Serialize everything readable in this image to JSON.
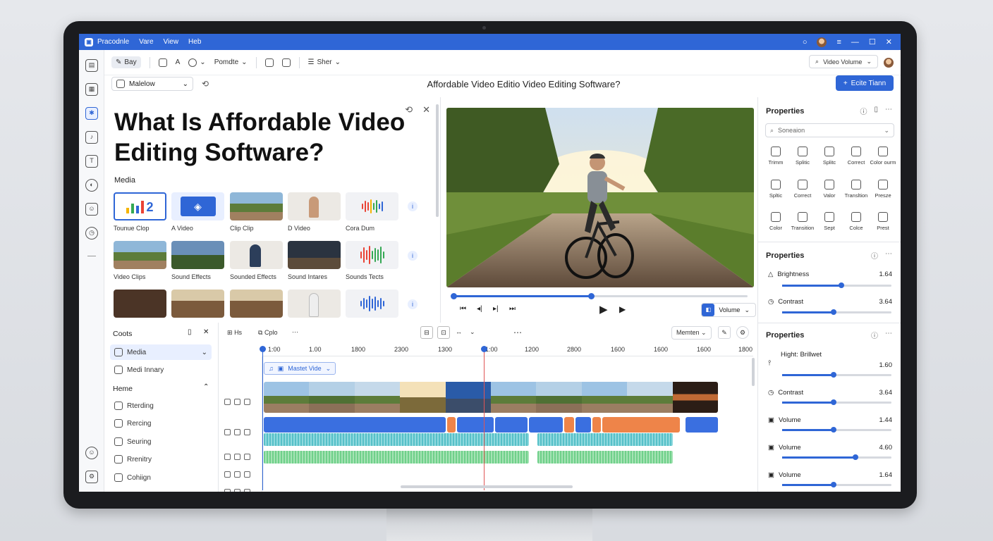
{
  "titlebar": {
    "app_name": "Рrасоdnlе",
    "menu": [
      "Vare",
      "View",
      "Heb"
    ]
  },
  "toolbar": {
    "edit_label": "Bay",
    "pointer_label": "Pomdte",
    "share_label": "Sher",
    "video_select": "Video Volume"
  },
  "subbar": {
    "dropdown": "Malelow",
    "document_title": "Affordable Video Editio Video Editing Software?",
    "edit_button": "Ecite Tiann"
  },
  "hero": {
    "heading": "What Is Affordable Video Editing Software?"
  },
  "media": {
    "label": "Media",
    "tiles": [
      {
        "label": "Tounue Clop"
      },
      {
        "label": "A Video"
      },
      {
        "label": "Clip Clip"
      },
      {
        "label": "D Video"
      },
      {
        "label": "Cora Dum"
      },
      {
        "label": "Video Clips"
      },
      {
        "label": "Sound Effects"
      },
      {
        "label": "Sounded Effects"
      },
      {
        "label": "Sound Intares"
      },
      {
        "label": "Sounds Tects"
      },
      {
        "label": ""
      },
      {
        "label": ""
      },
      {
        "label": ""
      },
      {
        "label": ""
      },
      {
        "label": ""
      }
    ]
  },
  "player": {
    "progress": 0.47,
    "volume_label": "Volume"
  },
  "properties": {
    "title": "Properties",
    "search_placeholder": "Soneaion",
    "tools": [
      "Trimm",
      "Splitic",
      "Splitc",
      "Correct",
      "Color ourm",
      "Spltic",
      "Correct",
      "Valor",
      "Transltion",
      "Presze",
      "Color",
      "Transition",
      "Sept",
      "Colce",
      "Prest"
    ],
    "section2": {
      "title": "Properties",
      "rows": [
        {
          "label": "Brightness",
          "value": "1.64",
          "level": 0.54
        },
        {
          "label": "Contrast",
          "value": "3.64",
          "level": 0.47
        }
      ]
    },
    "section3": {
      "title": "Properties",
      "rows": [
        {
          "label": "Hight: Brillwet",
          "value": "1.60",
          "level": 0.47
        },
        {
          "label": "Contrast",
          "value": "3.64",
          "level": 0.47
        },
        {
          "label": "Volume",
          "value": "1.44",
          "level": 0.47
        },
        {
          "label": "Volume",
          "value": "4.60",
          "level": 0.67
        },
        {
          "label": "Volume",
          "value": "1.64",
          "level": 0.47
        }
      ]
    }
  },
  "tools": {
    "title": "Coots",
    "items_top": [
      "Media",
      "Medi Innary"
    ],
    "section": "Heme",
    "items": [
      "Rterding",
      "Rercing",
      "Seuring",
      "Rrenitry",
      "Cohiign"
    ]
  },
  "timeline": {
    "tab1": "Hs",
    "tab2": "Cplo",
    "view_select": "Memten",
    "ruler": [
      "1:00",
      "1.00",
      "1800",
      "2300",
      "1300",
      "1:00",
      "1200",
      "2800",
      "1600",
      "1600",
      "1600",
      "1800"
    ],
    "track_label": "Mastet Vide"
  },
  "colors": {
    "accent": "#2f66d6",
    "clip_blue": "#3a6fe0",
    "clip_orange": "#ee8449",
    "audio_teal": "#56c0c8",
    "audio_green": "#6fd08a",
    "playhead": "#e05555"
  }
}
